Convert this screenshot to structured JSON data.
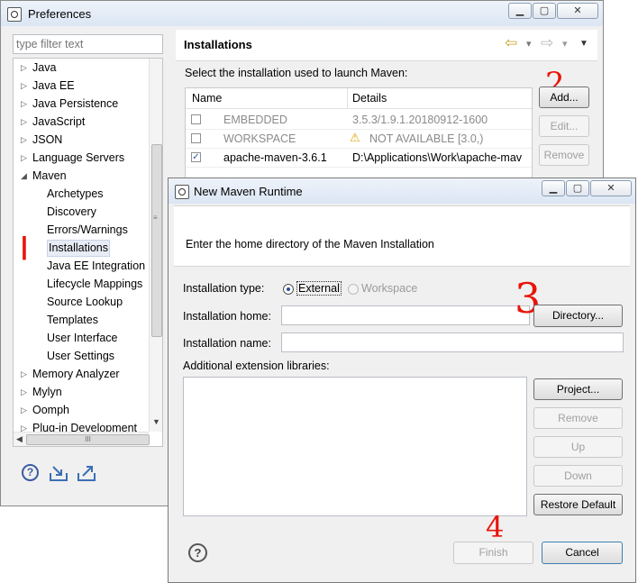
{
  "preferences": {
    "title": "Preferences",
    "filter_placeholder": "type filter text",
    "tree": [
      {
        "label": "Java",
        "indent": 0,
        "twisty": "▷"
      },
      {
        "label": "Java EE",
        "indent": 0,
        "twisty": "▷"
      },
      {
        "label": "Java Persistence",
        "indent": 0,
        "twisty": "▷"
      },
      {
        "label": "JavaScript",
        "indent": 0,
        "twisty": "▷"
      },
      {
        "label": "JSON",
        "indent": 0,
        "twisty": "▷"
      },
      {
        "label": "Language Servers",
        "indent": 0,
        "twisty": "▷"
      },
      {
        "label": "Maven",
        "indent": 0,
        "twisty": "◢"
      },
      {
        "label": "Archetypes",
        "indent": 1,
        "twisty": ""
      },
      {
        "label": "Discovery",
        "indent": 1,
        "twisty": ""
      },
      {
        "label": "Errors/Warnings",
        "indent": 1,
        "twisty": ""
      },
      {
        "label": "Installations",
        "indent": 1,
        "twisty": "",
        "selected": true
      },
      {
        "label": "Java EE Integration",
        "indent": 1,
        "twisty": ""
      },
      {
        "label": "Lifecycle Mappings",
        "indent": 1,
        "twisty": ""
      },
      {
        "label": "Source Lookup",
        "indent": 1,
        "twisty": ""
      },
      {
        "label": "Templates",
        "indent": 1,
        "twisty": ""
      },
      {
        "label": "User Interface",
        "indent": 1,
        "twisty": ""
      },
      {
        "label": "User Settings",
        "indent": 1,
        "twisty": ""
      },
      {
        "label": "Memory Analyzer",
        "indent": 0,
        "twisty": "▷"
      },
      {
        "label": "Mylyn",
        "indent": 0,
        "twisty": "▷"
      },
      {
        "label": "Oomph",
        "indent": 0,
        "twisty": "▷"
      },
      {
        "label": "Plug-in Development",
        "indent": 0,
        "twisty": "▷"
      }
    ],
    "hscroll_grip": "III",
    "page_title": "Installations",
    "description": "Select the installation used to launch Maven:",
    "table_headers": {
      "name": "Name",
      "details": "Details"
    },
    "table_rows": [
      {
        "checked": false,
        "name": "EMBEDDED",
        "details": "3.5.3/1.9.1.20180912-1600",
        "disabled": true,
        "warn": false
      },
      {
        "checked": false,
        "name": "WORKSPACE",
        "details": "NOT AVAILABLE [3.0,)",
        "disabled": true,
        "warn": true
      },
      {
        "checked": true,
        "name": "apache-maven-3.6.1",
        "details": "D:\\Applications\\Work\\apache-mav",
        "disabled": false,
        "warn": false
      }
    ],
    "buttons": {
      "add": "Add...",
      "edit": "Edit...",
      "remove": "Remove"
    },
    "annotations": {
      "one": "|",
      "two": "2"
    },
    "nav": {
      "back": "⇦",
      "fwd": "⇨",
      "menu": "▼",
      "dd": "▾"
    }
  },
  "dialog": {
    "title": "New Maven Runtime",
    "message": "Enter the home directory of the Maven Installation",
    "installation_type_label": "Installation type:",
    "type_external": "External",
    "type_workspace": "Workspace",
    "home_label": "Installation home:",
    "home_value": "",
    "name_label": "Installation name:",
    "name_value": "",
    "directory_button": "Directory...",
    "ext_libs_label": "Additional extension libraries:",
    "side_buttons": {
      "project": "Project...",
      "remove": "Remove",
      "up": "Up",
      "down": "Down",
      "restore": "Restore Default"
    },
    "finish": "Finish",
    "cancel": "Cancel",
    "annotations": {
      "three": "3",
      "four": "4"
    }
  },
  "window_buttons": {
    "min": "▁",
    "max": "▢",
    "close": "✕"
  }
}
